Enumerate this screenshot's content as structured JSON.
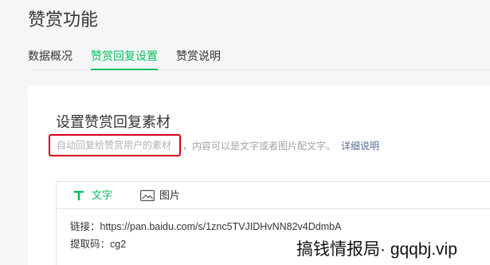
{
  "page": {
    "title": "赞赏功能"
  },
  "nav_tabs": [
    {
      "label": "数据概况",
      "active": false
    },
    {
      "label": "赞赏回复设置",
      "active": true
    },
    {
      "label": "赞赏说明",
      "active": false
    }
  ],
  "reply_settings": {
    "heading": "设置赞赏回复素材",
    "hint": {
      "highlighted": "自动回复给赞赏用户的素材",
      "rest": "，内容可以是文字或者图片配文字。",
      "link": "详细说明"
    },
    "editor": {
      "tabs": [
        {
          "label": "文字",
          "icon": "text-format-icon",
          "active": true
        },
        {
          "label": "图片",
          "icon": "image-icon",
          "active": false
        }
      ],
      "content_lines": [
        "链接：https://pan.baidu.com/s/1znc5TVJIDHvNN82v4DdmbA",
        "提取码：cg2"
      ]
    }
  },
  "watermark": {
    "text": "搞钱情报局· gqqbj.vip"
  },
  "colors": {
    "accent": "#07c160",
    "link": "#576b95",
    "highlight_border": "#d9001b",
    "page_background": "#f5f6f7",
    "card_background": "#ffffff"
  }
}
